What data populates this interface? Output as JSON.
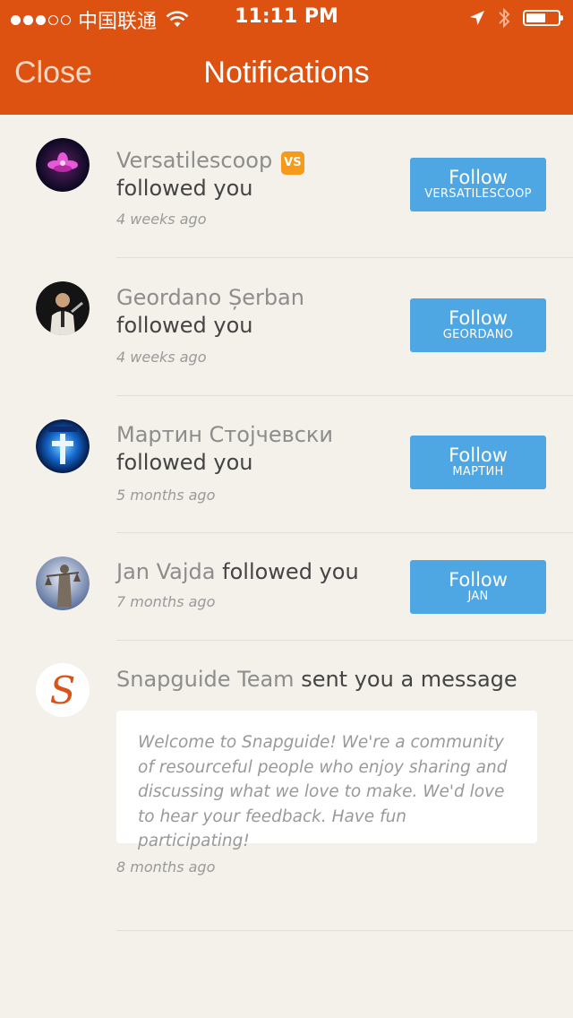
{
  "status_bar": {
    "carrier": "中国联通",
    "time": "11:11 PM"
  },
  "nav": {
    "close_label": "Close",
    "title": "Notifications"
  },
  "notifications": [
    {
      "name": "Versatilescoop",
      "badge": "VS",
      "action": "followed you",
      "time": "4 weeks ago",
      "follow_label": "Follow",
      "follow_user": "VERSATILESCOOP"
    },
    {
      "name": "Geordano Șerban",
      "action": "followed you",
      "time": "4 weeks ago",
      "follow_label": "Follow",
      "follow_user": "GEORDANO"
    },
    {
      "name": "Мартин Стојчевски",
      "action": "followed you",
      "time": "5 months ago",
      "follow_label": "Follow",
      "follow_user": "МАРТИН"
    },
    {
      "name": "Jan Vajda",
      "action": "followed you",
      "time": "7 months ago",
      "follow_label": "Follow",
      "follow_user": "JAN"
    },
    {
      "name": "Snapguide Team",
      "action": "sent you a message",
      "message": "Welcome to Snapguide! We're a community of resourceful people who enjoy sharing and discussing what we love to make. We'd love to hear your feedback. Have fun participating!",
      "time": "8 months ago",
      "avatar_letter": "S"
    }
  ],
  "colors": {
    "accent": "#dd5210",
    "follow_button": "#4ea6e2",
    "background": "#f4f0ea"
  }
}
